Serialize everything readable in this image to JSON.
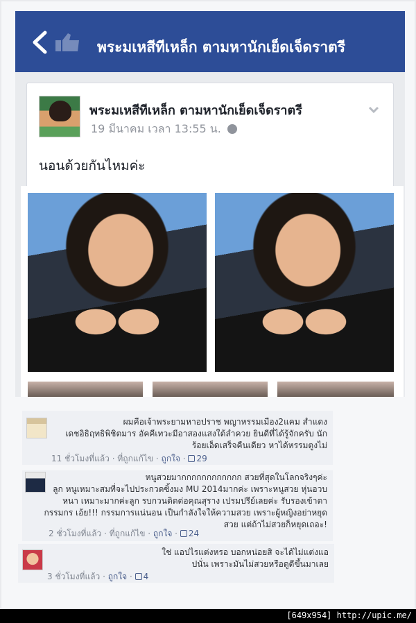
{
  "header": {
    "title": "พระมเหสีทีเหล็ก ตามหานักเย็ดเจ็ดราตรี"
  },
  "post": {
    "author": "พระมเหสีทีเหล็ก ตามหานักเย็ดเจ็ดราตรี",
    "timestamp": "19 มีนาคม เวลา 13:55 น.",
    "text": "นอนด้วยกันไหมค่ะ"
  },
  "comments": [
    {
      "lines": [
        "ผมคือเจ้าพระยามหาอปราช พญาหรรมเมือง2แคม สำแดง",
        "เดชอิธิฤทธิพิชิตมาร อัคคีเทวะมีอาสองแสงใต้ลำควย ยินดีที่ได้รู้จักครับ นัก",
        "ร้อยเอ็ดเสร็จคืนเดียว หาได้หรรมตูงไม่"
      ],
      "time": "11 ชั่วโมงที่แล้ว",
      "action1": "ที่ถูกแก้ไข",
      "action2": "ถูกใจ",
      "likes": "29"
    },
    {
      "lines": [
        "หนูสวยมากกกกกกกกกกกก สวยที่สุดในโลกจริงๆค่ะ",
        "ลูก หนูเหมาะสมที่จะไปประกวดซิ้งมง MU 2014มากค่ะ เพราะหนูสวย หุ่นอวบ",
        "หนา เหมาะมากค่ะลูก รบกวนติดต่อคุณสุราง เปรมปรีย์เลยค่ะ รับรองเข้าตา",
        "กรรมกร เอ้ย!!! กรรมการแน่นอน เป็นกำลังใจให้ความสวย เพราะผู้หญิงอย่าหยุด",
        "สวย แต่ถ้าไม่สวยก็หยุดเถอะ!"
      ],
      "time": "2 ชั่วโมงที่แล้ว",
      "action1": "ที่ถูกแก้ไข",
      "action2": "ถูกใจ",
      "likes": "24"
    },
    {
      "lines": [
        "ใช่ แอปไรแต่งหรอ บอกหน่อยสิ จะได้ไม่แต่งแอ",
        "ปนั่น เพราะมันไม่สวยหรือดูดีขึ้นมาเลย"
      ],
      "time": "3 ชั่วโมงที่แล้ว",
      "action1": "ถูกใจ",
      "likes": "4"
    }
  ],
  "watermark": "[649x954] http://upic.me/",
  "colors": {
    "header_bg": "#2d4d97",
    "link": "#4b5f8c"
  },
  "icons": [
    "back-arrow-icon",
    "like-icon",
    "globe-icon",
    "chevron-down-icon",
    "thumbs-up-icon"
  ]
}
